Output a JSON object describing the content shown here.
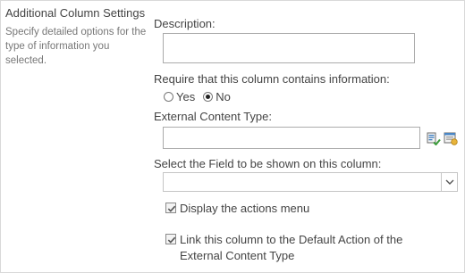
{
  "section": {
    "title": "Additional Column Settings",
    "description": "Specify detailed options for the type of information you selected."
  },
  "description_field": {
    "label": "Description:",
    "value": ""
  },
  "require": {
    "label": "Require that this column contains information:",
    "options": [
      {
        "label": "Yes",
        "selected": false
      },
      {
        "label": "No",
        "selected": true
      }
    ]
  },
  "external_content_type": {
    "label": "External Content Type:",
    "value": "",
    "icons": [
      "check-external-content-type-icon",
      "browse-external-content-type-icon"
    ]
  },
  "field_select": {
    "label": "Select the Field to be shown on this column:",
    "value": ""
  },
  "display_actions": {
    "label": "Display the actions menu",
    "checked": true
  },
  "link_column": {
    "label": "Link this column to the Default Action of the External Content Type",
    "checked": true
  },
  "colors": {
    "border": "#ababab",
    "label": "#444444",
    "muted": "#777777"
  }
}
